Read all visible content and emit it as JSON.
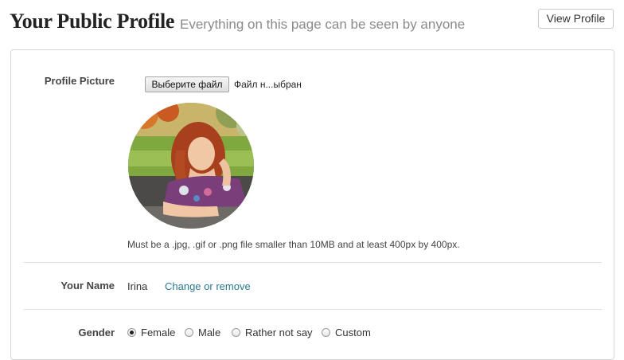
{
  "header": {
    "title": "Your Public Profile",
    "subtitle": "Everything on this page can be seen by anyone",
    "view_profile_label": "View Profile"
  },
  "profile_picture": {
    "label": "Profile Picture",
    "file_button_label": "Выберите файл",
    "file_status": "Файл н...ыбран",
    "avatar_icon": "profile-photo",
    "hint": "Must be a .jpg, .gif or .png file smaller than 10MB and at least 400px by 400px."
  },
  "name": {
    "label": "Your Name",
    "value": "Irina",
    "change_link": "Change or remove"
  },
  "gender": {
    "label": "Gender",
    "options": [
      {
        "label": "Female",
        "checked": true
      },
      {
        "label": "Male",
        "checked": false
      },
      {
        "label": "Rather not say",
        "checked": false
      },
      {
        "label": "Custom",
        "checked": false
      }
    ]
  },
  "colors": {
    "link": "#2a7a8f",
    "subtitle": "#8a8a8a",
    "border": "#d6d6d6"
  }
}
